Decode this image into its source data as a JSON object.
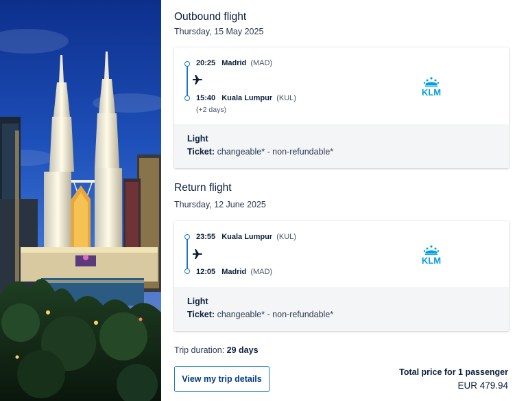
{
  "hero": {
    "image": "kuala-lumpur-petronas-towers-night"
  },
  "outbound": {
    "title": "Outbound flight",
    "date": "Thursday, 15 May 2025",
    "departure": {
      "time": "20:25",
      "city": "Madrid",
      "code": "(MAD)"
    },
    "arrival": {
      "time": "15:40",
      "city": "Kuala Lumpur",
      "code": "(KUL)",
      "note": "(+2 days)"
    },
    "airline": "KLM",
    "fare": "Light",
    "ticket_label": "Ticket:",
    "ticket_value": "changeable* - non-refundable*"
  },
  "return": {
    "title": "Return flight",
    "date": "Thursday, 12 June 2025",
    "departure": {
      "time": "23:55",
      "city": "Kuala Lumpur",
      "code": "(KUL)"
    },
    "arrival": {
      "time": "12:05",
      "city": "Madrid",
      "code": "(MAD)"
    },
    "airline": "KLM",
    "fare": "Light",
    "ticket_label": "Ticket:",
    "ticket_value": "changeable* - non-refundable*"
  },
  "summary": {
    "duration_label": "Trip duration:",
    "duration_value": "29 days",
    "details_button": "View my trip details",
    "total_label": "Total price for 1 passenger",
    "total_value": "EUR 479.94"
  },
  "colors": {
    "accent": "#1a76c6",
    "klm_blue": "#00a1de",
    "text": "#0b1f3a"
  }
}
